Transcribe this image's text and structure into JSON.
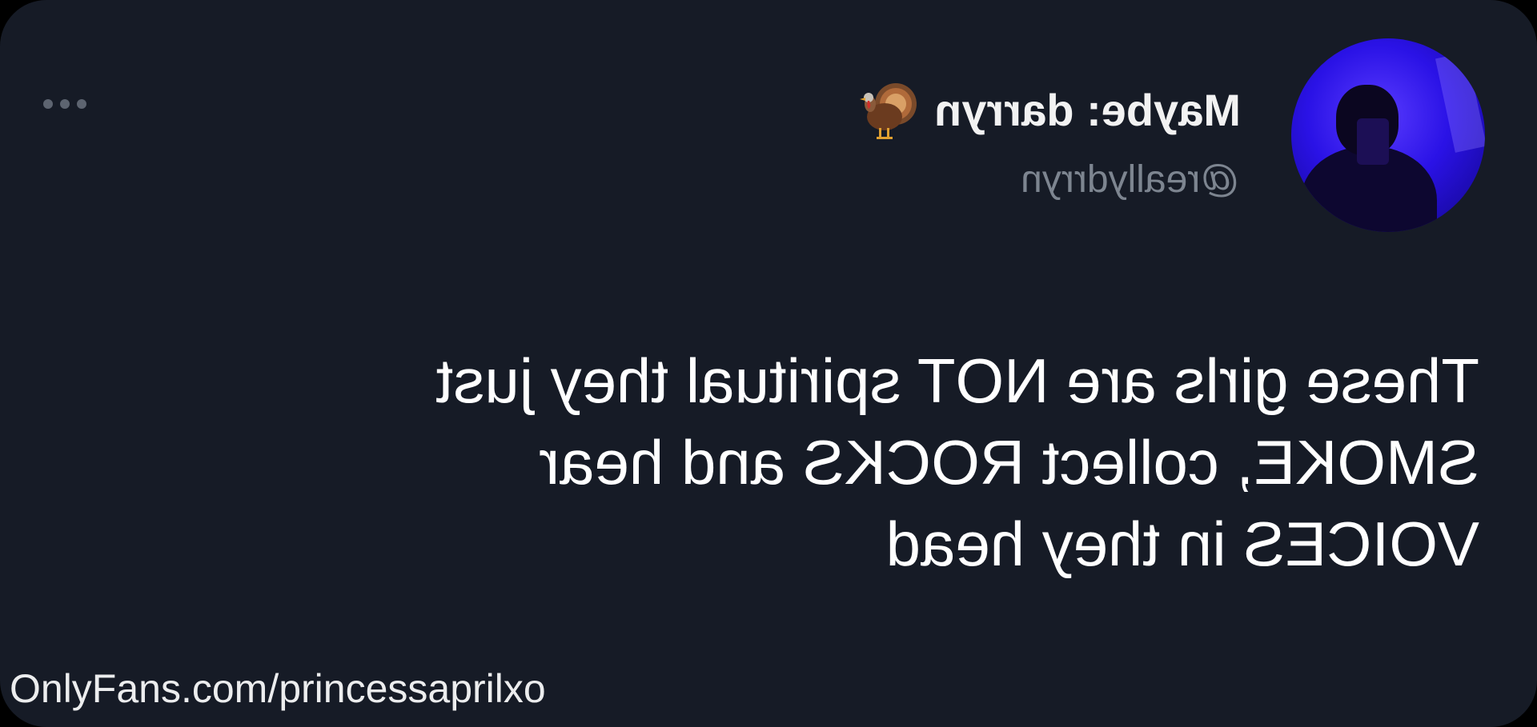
{
  "tweet": {
    "display_name": "Maybe: darryn",
    "name_emoji": "turkey-icon",
    "handle": "@reallydrryn",
    "text_lines": [
      "These girls are NOT spiritual they just",
      "SMOKE, collect ROCKS and hear",
      "VOICES in they head"
    ],
    "more_icon": "more-options-icon",
    "mirrored": true
  },
  "watermark": {
    "text": "OnlyFans.com/princessaprilxo"
  },
  "colors": {
    "card_background": "#161b26",
    "avatar_background": "#2a12e6",
    "text_primary": "#ffffff",
    "text_secondary": "#7d8590"
  }
}
